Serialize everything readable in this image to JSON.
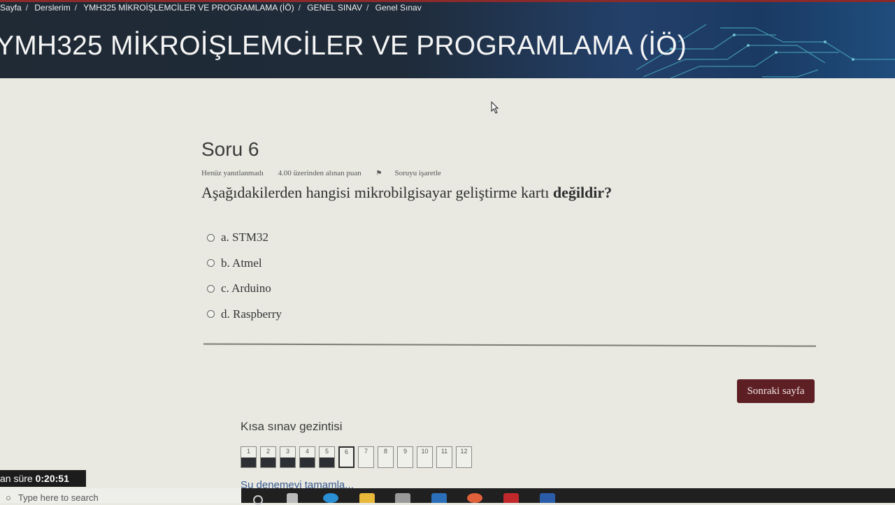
{
  "breadcrumb": [
    "Sayfa",
    "Derslerim",
    "YMH325 MİKROİŞLEMCİLER VE PROGRAMLAMA (İÖ)",
    "GENEL SINAV",
    "Genel Sınav"
  ],
  "course_title": "YMH325 MİKROİŞLEMCİLER VE PROGRAMLAMA (İÖ)",
  "question": {
    "title": "Soru 6",
    "status": "Henüz yanıtlanmadı",
    "points": "4.00 üzerinden alınan puan",
    "flag_label": "Soruyu işaretle",
    "text_plain": "Aşağıdakilerden hangisi mikrobilgisayar geliştirme kartı",
    "text_bold": "değildir?",
    "answers": [
      "a. STM32",
      "b. Atmel",
      "c. Arduino",
      "d. Raspberry"
    ]
  },
  "next_button": "Sonraki sayfa",
  "navigation": {
    "title": "Kısa sınav gezintisi",
    "cells": [
      "1",
      "2",
      "3",
      "4",
      "5",
      "6",
      "7",
      "8",
      "9",
      "10",
      "11",
      "12"
    ],
    "answered": [
      true,
      true,
      true,
      true,
      true,
      false,
      false,
      false,
      false,
      false,
      false,
      false
    ],
    "current_index": 5,
    "finish_link": "Şu denemeyi tamamla..."
  },
  "timer": {
    "label": "an süre",
    "value": "0:20:51"
  },
  "taskbar": {
    "search_placeholder": "Type here to search"
  },
  "colors": {
    "accent": "#5e1f24",
    "header_bg": "#1f2a35"
  }
}
